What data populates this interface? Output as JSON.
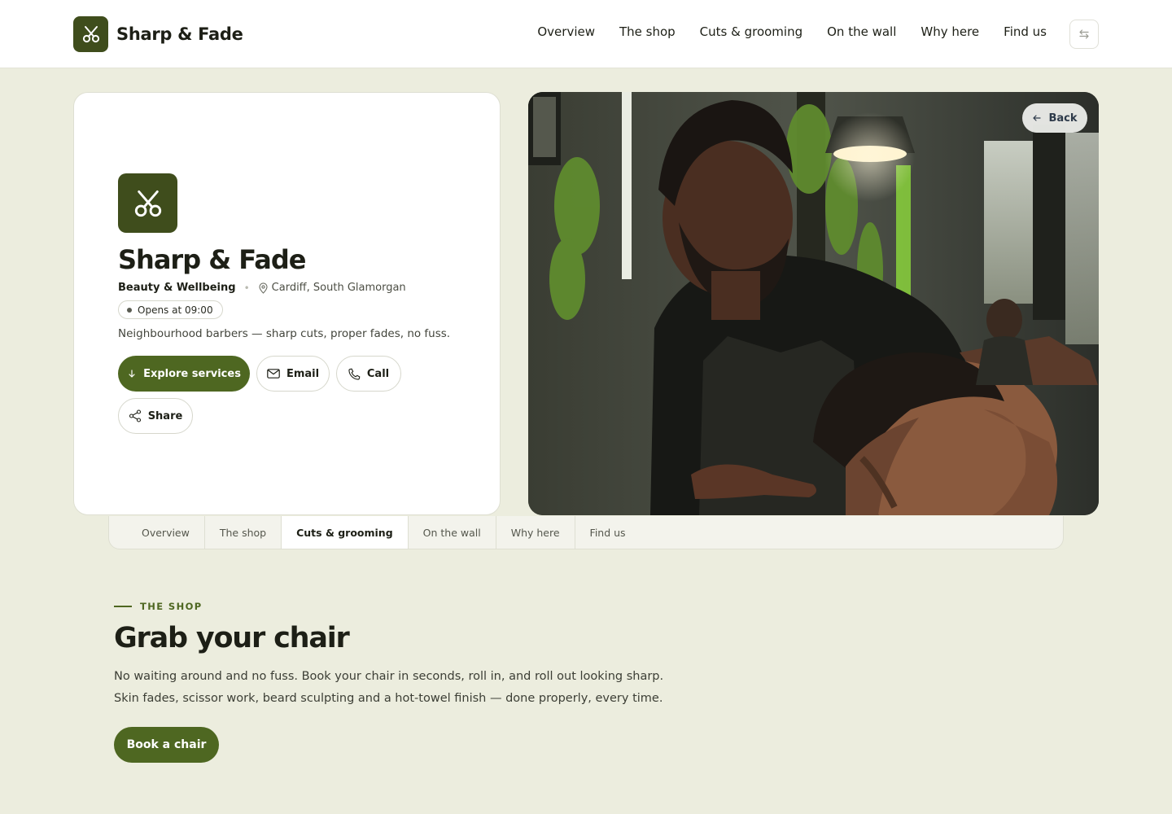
{
  "brand": {
    "name": "Sharp & Fade",
    "logo_icon": "scissors-icon",
    "color": "#3f4d1c"
  },
  "nav": {
    "items": [
      "Overview",
      "The shop",
      "Cuts & grooming",
      "On the wall",
      "Why here",
      "Find us"
    ],
    "swap_icon": "swap-arrows-icon"
  },
  "hero": {
    "title": "Sharp & Fade",
    "category": "Beauty & Wellbeing",
    "location": "Cardiff, South Glamorgan",
    "status": "Opens at 09:00",
    "tagline": "Neighbourhood barbers — sharp cuts, proper fades, no fuss.",
    "buttons": {
      "explore": "Explore services",
      "email": "Email",
      "call": "Call",
      "share": "Share"
    },
    "accent": "#4e6721"
  },
  "photo": {
    "back_label": "Back"
  },
  "subtabs": {
    "items": [
      "Overview",
      "The shop",
      "Cuts & grooming",
      "On the wall",
      "Why here",
      "Find us"
    ],
    "active": "Cuts & grooming"
  },
  "section": {
    "eyebrow": "THE SHOP",
    "title": "Grab your chair",
    "body": [
      "No waiting around and no fuss. Book your chair in seconds, roll in, and roll out looking sharp.",
      "Skin fades, scissor work, beard sculpting and a hot-towel finish — done properly, every time."
    ],
    "cta": "Book a chair"
  }
}
